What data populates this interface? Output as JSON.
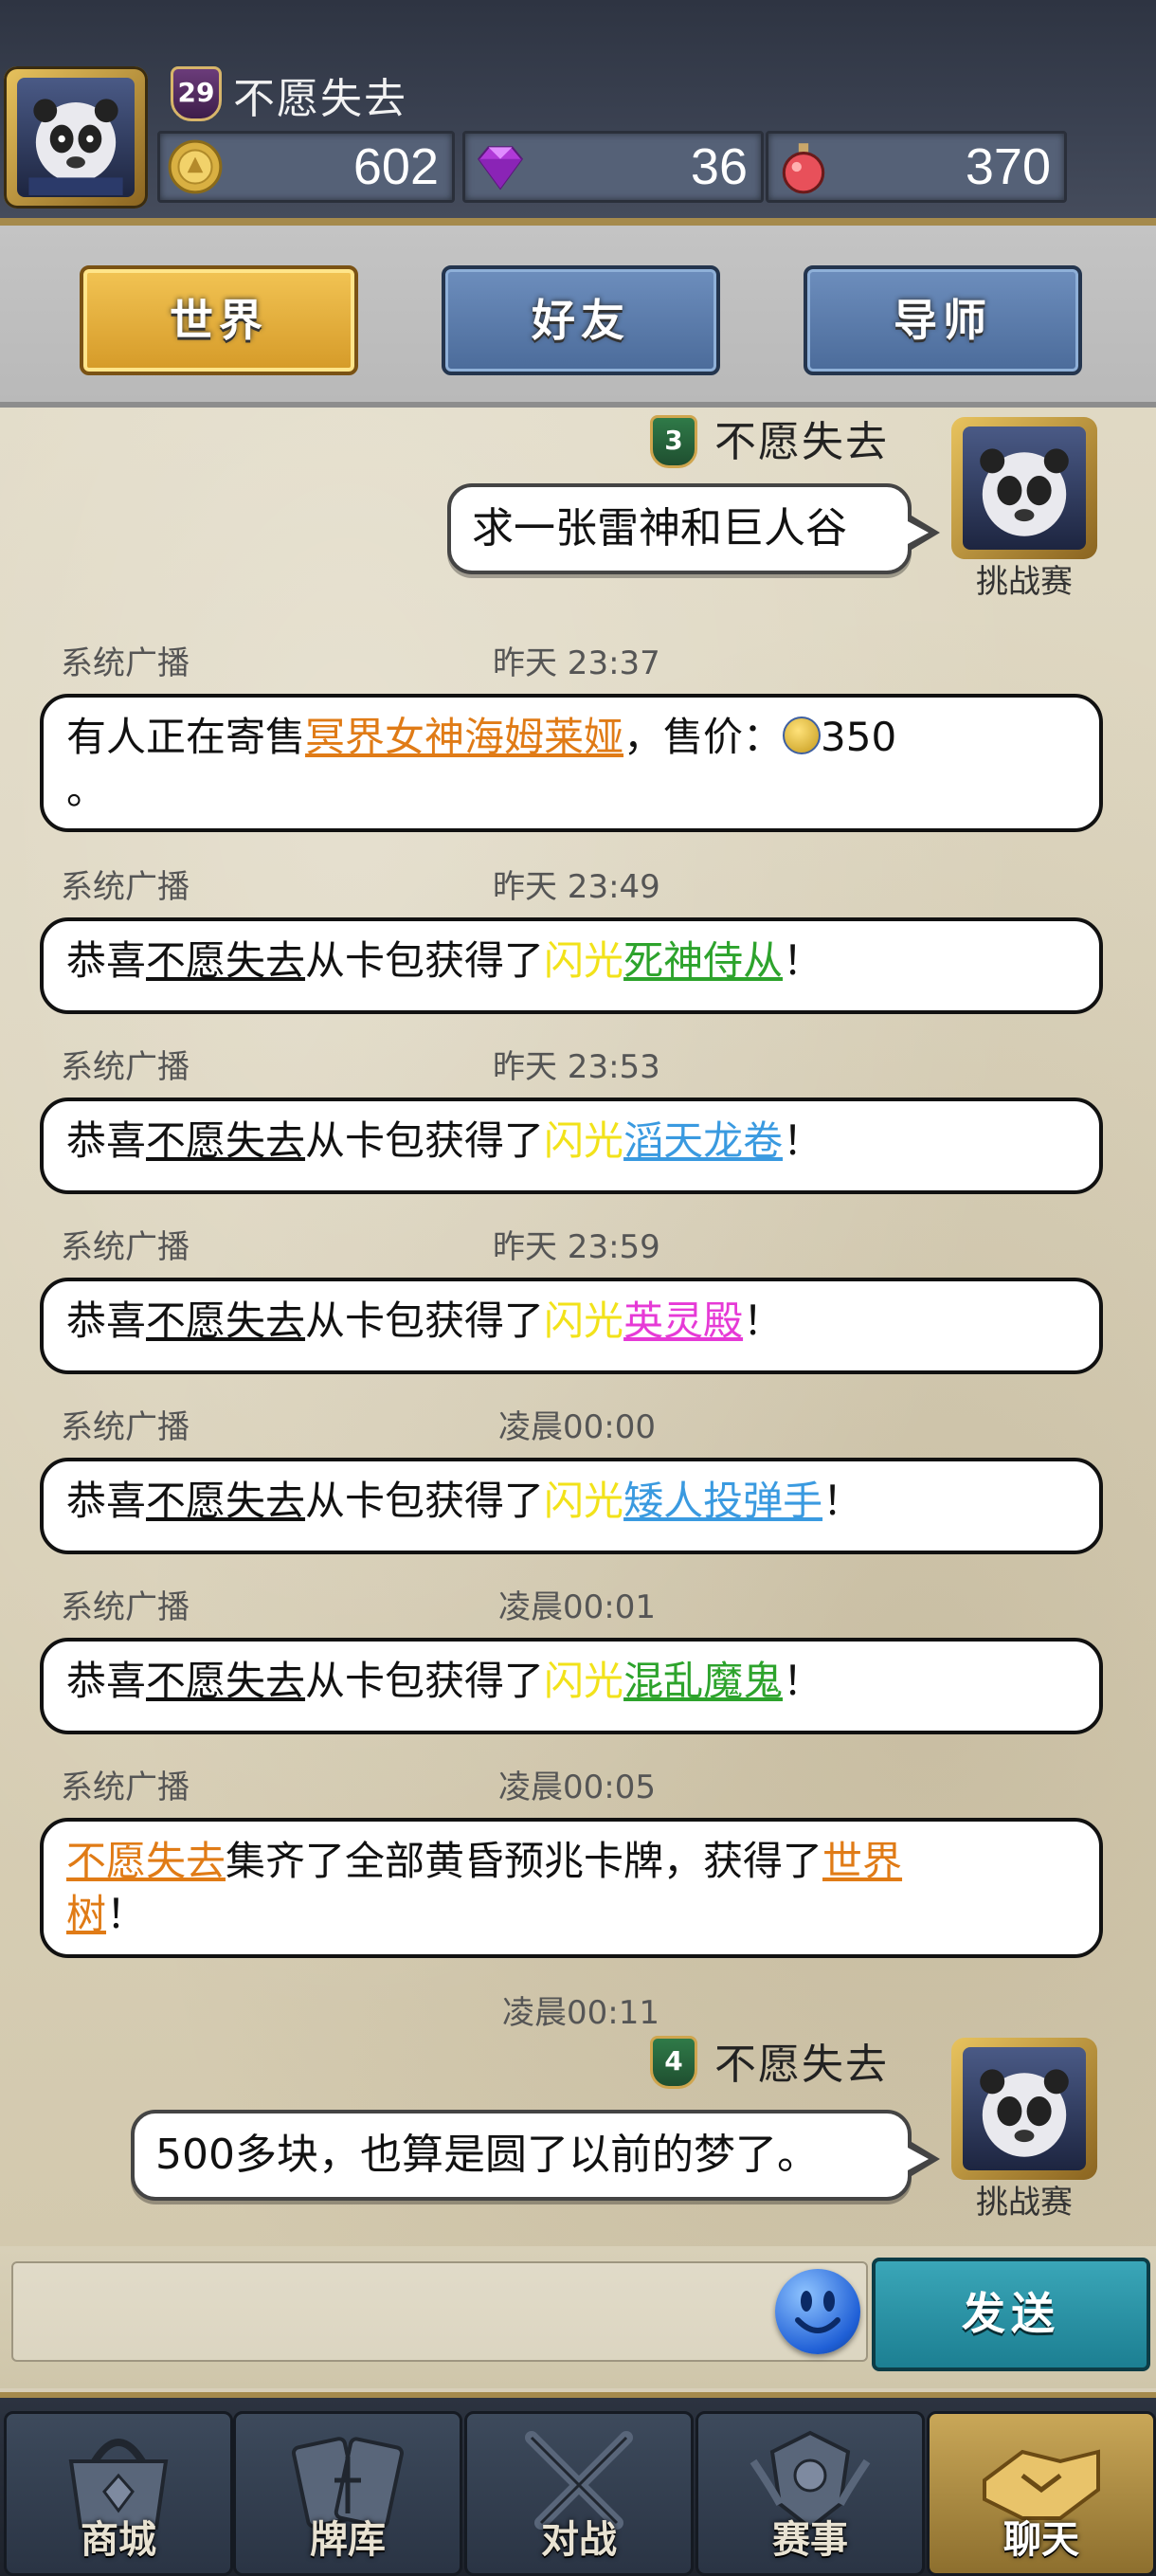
{
  "header": {
    "player_level": "29",
    "player_name": "不愿失去",
    "resources": [
      {
        "icon": "gold-coin-icon",
        "value": "602"
      },
      {
        "icon": "purple-gem-icon",
        "value": "36"
      },
      {
        "icon": "potion-icon",
        "value": "370"
      }
    ]
  },
  "tabs": [
    {
      "label": "世界",
      "active": true
    },
    {
      "label": "好友",
      "active": false
    },
    {
      "label": "导师",
      "active": false
    }
  ],
  "messages": {
    "user1": {
      "level": "3",
      "name": "不愿失去",
      "text": "求一张雷神和巨人谷",
      "caption": "挑战赛"
    },
    "sys": [
      {
        "sender": "系统广播",
        "time": "昨天  23:37"
      },
      {
        "sender": "系统广播",
        "time": "昨天  23:49"
      },
      {
        "sender": "系统广播",
        "time": "昨天  23:53"
      },
      {
        "sender": "系统广播",
        "time": "昨天  23:59"
      },
      {
        "sender": "系统广播",
        "time": "凌晨00:00"
      },
      {
        "sender": "系统广播",
        "time": "凌晨00:01"
      },
      {
        "sender": "系统广播",
        "time": "凌晨00:05"
      }
    ],
    "sale": {
      "prefix": "有人正在寄售",
      "item": "冥界女神海姆莱娅",
      "mid": "，售价：",
      "price": "350",
      "end": "。"
    },
    "grants": [
      {
        "pre": "恭喜",
        "user": "不愿失去",
        "mid": "从卡包获得了",
        "shine": "闪光",
        "card": "死神侍从",
        "end": "！"
      },
      {
        "pre": "恭喜",
        "user": "不愿失去",
        "mid": "从卡包获得了",
        "shine": "闪光",
        "card": "滔天龙卷",
        "end": "！"
      },
      {
        "pre": "恭喜",
        "user": "不愿失去",
        "mid": "从卡包获得了",
        "shine": "闪光",
        "card": "英灵殿",
        "end": "！"
      },
      {
        "pre": "恭喜",
        "user": "不愿失去",
        "mid": "从卡包获得了",
        "shine": "闪光",
        "card": "矮人投弹手",
        "end": "！"
      },
      {
        "pre": "恭喜",
        "user": "不愿失去",
        "mid": "从卡包获得了",
        "shine": "闪光",
        "card": "混乱魔鬼",
        "end": "！"
      }
    ],
    "collect": {
      "user": "不愿失去",
      "mid": "集齐了全部黄昏预兆卡牌，获得了",
      "reward1": "世界",
      "reward2": "树",
      "end": "！"
    },
    "center_time": "凌晨00:11",
    "user2": {
      "level": "4",
      "name": "不愿失去",
      "text": "500多块，也算是圆了以前的梦了。",
      "caption": "挑战赛"
    }
  },
  "input": {
    "value": "",
    "placeholder": "",
    "send_label": "发送"
  },
  "bottom_nav": [
    {
      "label": "商城",
      "icon": "shop-icon",
      "active": false
    },
    {
      "label": "牌库",
      "icon": "card-deck-icon",
      "active": false
    },
    {
      "label": "对战",
      "icon": "crossed-swords-icon",
      "active": false
    },
    {
      "label": "赛事",
      "icon": "tournament-emblem-icon",
      "active": false
    },
    {
      "label": "聊天",
      "icon": "handshake-chat-icon",
      "active": true
    }
  ]
}
